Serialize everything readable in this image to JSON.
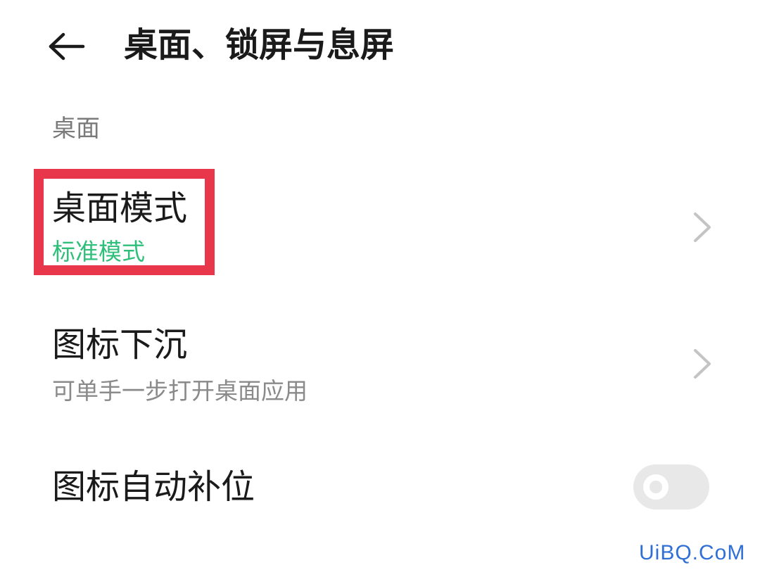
{
  "header": {
    "back_icon": "arrow-left-icon",
    "title": "桌面、锁屏与息屏"
  },
  "section": {
    "label": "桌面"
  },
  "settings": [
    {
      "title": "桌面模式",
      "subtitle": "标准模式",
      "control": "chevron-right-icon",
      "highlighted": true
    },
    {
      "title": "图标下沉",
      "subtitle": "可单手一步打开桌面应用",
      "control": "chevron-right-icon"
    },
    {
      "title": "图标自动补位",
      "control": "toggle",
      "toggle_on": false
    }
  ],
  "watermark": {
    "text": "UiBQ.CoM"
  },
  "colors": {
    "accent_green": "#2fbf7a",
    "highlight_red": "#e8374b",
    "watermark_blue": "#2f6fd6"
  }
}
